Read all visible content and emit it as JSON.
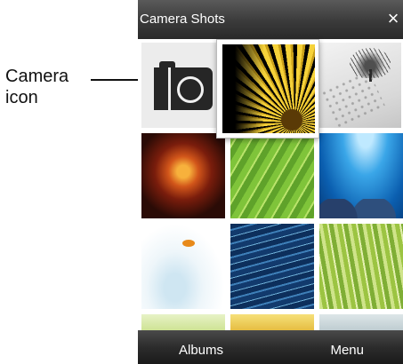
{
  "callout": {
    "line1": "Camera",
    "line2": "icon"
  },
  "titlebar": {
    "title": "Camera Shots",
    "close_glyph": "×"
  },
  "grid": {
    "tiles": [
      {
        "icon": "camera-icon"
      },
      {
        "image": "yellow-flower-closeup"
      },
      {
        "image": "tree-in-snow"
      },
      {
        "image": "fire-flower"
      },
      {
        "image": "green-leaf"
      },
      {
        "image": "underwater-reef"
      },
      {
        "image": "goldfish-splash"
      },
      {
        "image": "blue-water"
      },
      {
        "image": "green-grass"
      },
      {
        "image": "partial-light-green"
      },
      {
        "image": "partial-yellow"
      },
      {
        "image": "partial-gray"
      }
    ]
  },
  "bottombar": {
    "left_softkey": "Albums",
    "right_softkey": "Menu"
  }
}
